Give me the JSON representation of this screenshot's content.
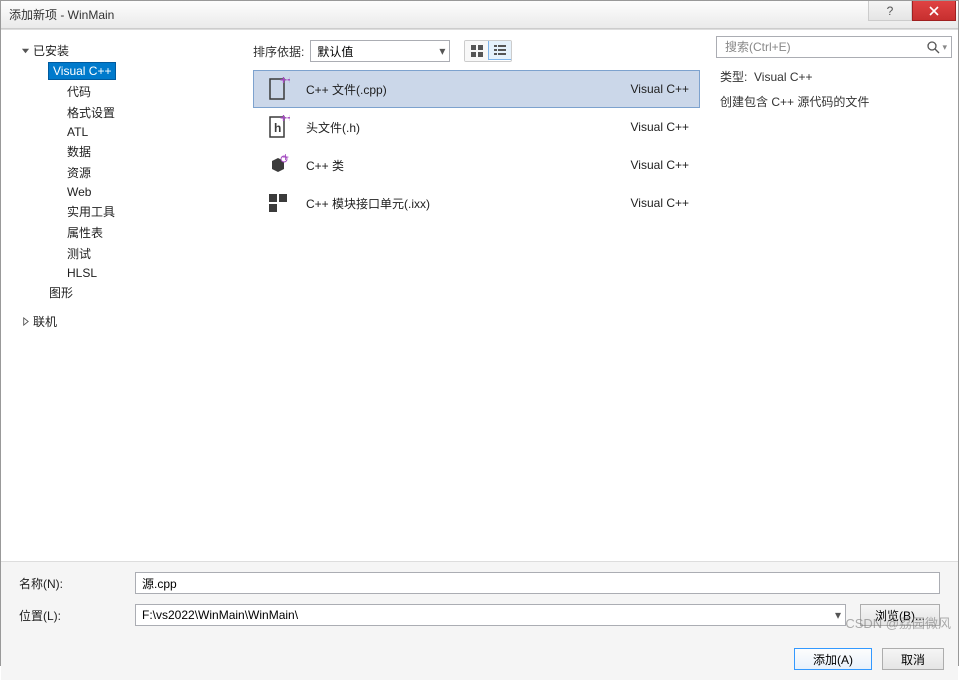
{
  "window": {
    "title": "添加新项 - WinMain"
  },
  "tree": {
    "installed": "已安装",
    "visualcpp": "Visual C++",
    "code": "代码",
    "format": "格式设置",
    "atl": "ATL",
    "data": "数据",
    "resource": "资源",
    "web": "Web",
    "utility": "实用工具",
    "propsheet": "属性表",
    "test": "测试",
    "hlsl": "HLSL",
    "graphics": "图形",
    "online": "联机"
  },
  "toolbar": {
    "sort_label": "排序依据:",
    "sort_value": "默认值"
  },
  "search": {
    "placeholder": "搜索(Ctrl+E)"
  },
  "items": [
    {
      "name": "C++ 文件(.cpp)",
      "lang": "Visual C++"
    },
    {
      "name": "头文件(.h)",
      "lang": "Visual C++"
    },
    {
      "name": "C++ 类",
      "lang": "Visual C++"
    },
    {
      "name": "C++ 模块接口单元(.ixx)",
      "lang": "Visual C++"
    }
  ],
  "detail": {
    "type_label": "类型:",
    "type_value": "Visual C++",
    "description": "创建包含 C++ 源代码的文件"
  },
  "form": {
    "name_label": "名称(N):",
    "name_value": "源.cpp",
    "location_label": "位置(L):",
    "location_value": "F:\\vs2022\\WinMain\\WinMain\\",
    "browse_label": "浏览(B)..."
  },
  "footer": {
    "add": "添加(A)",
    "cancel": "取消"
  },
  "watermark": "CSDN @荔园微风"
}
